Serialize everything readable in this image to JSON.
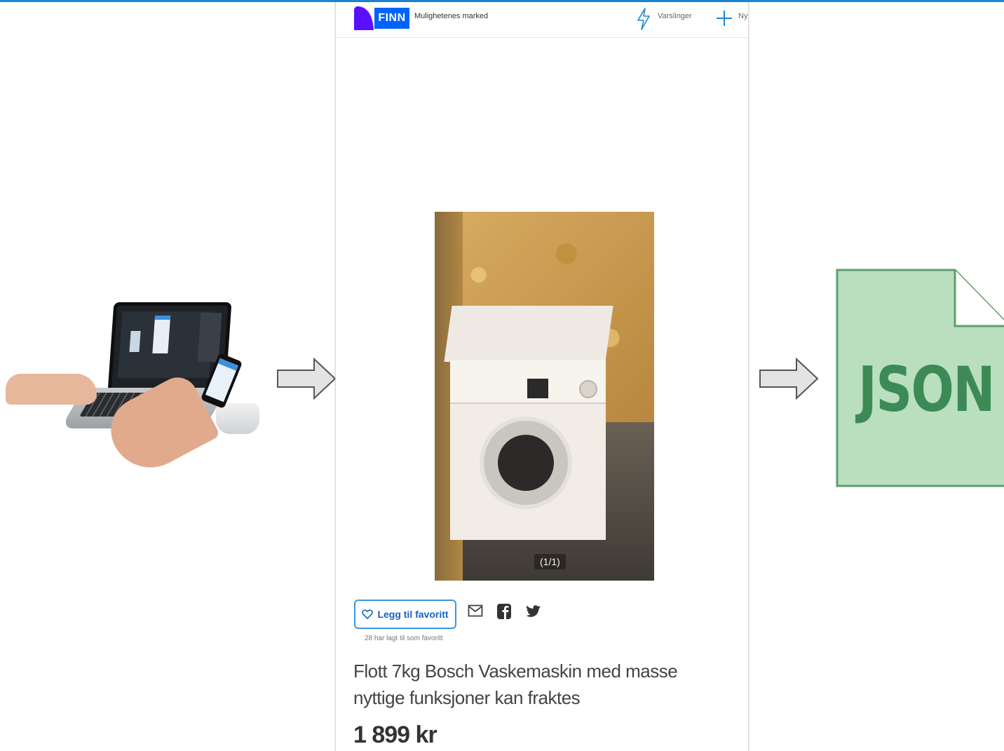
{
  "finn": {
    "logo_text": "FINN",
    "tagline": "Mulighetenes marked",
    "notifications_label": "Varslinger",
    "new_label": "Ny",
    "image_counter": "(1/1)",
    "favorite_button_label": "Legg til favoritt",
    "favorite_count_text": "28 har lagt til som favoritt",
    "listing_title": "Flott 7kg Bosch Vaskemaskin med masse nyttige funksjoner kan fraktes",
    "price": "1 899 kr"
  },
  "json_file": {
    "label": "JSON"
  },
  "colors": {
    "finn_blue": "#0063fb",
    "logo_purple": "#5a0fff",
    "accent_blue": "#3a98e6",
    "json_green_fill": "#b9dfbf",
    "json_green_text": "#3d8a57"
  },
  "icons": [
    "bolt-icon",
    "plus-icon",
    "heart-icon",
    "mail-icon",
    "facebook-icon",
    "twitter-icon",
    "arrow-right-icon",
    "file-icon"
  ]
}
